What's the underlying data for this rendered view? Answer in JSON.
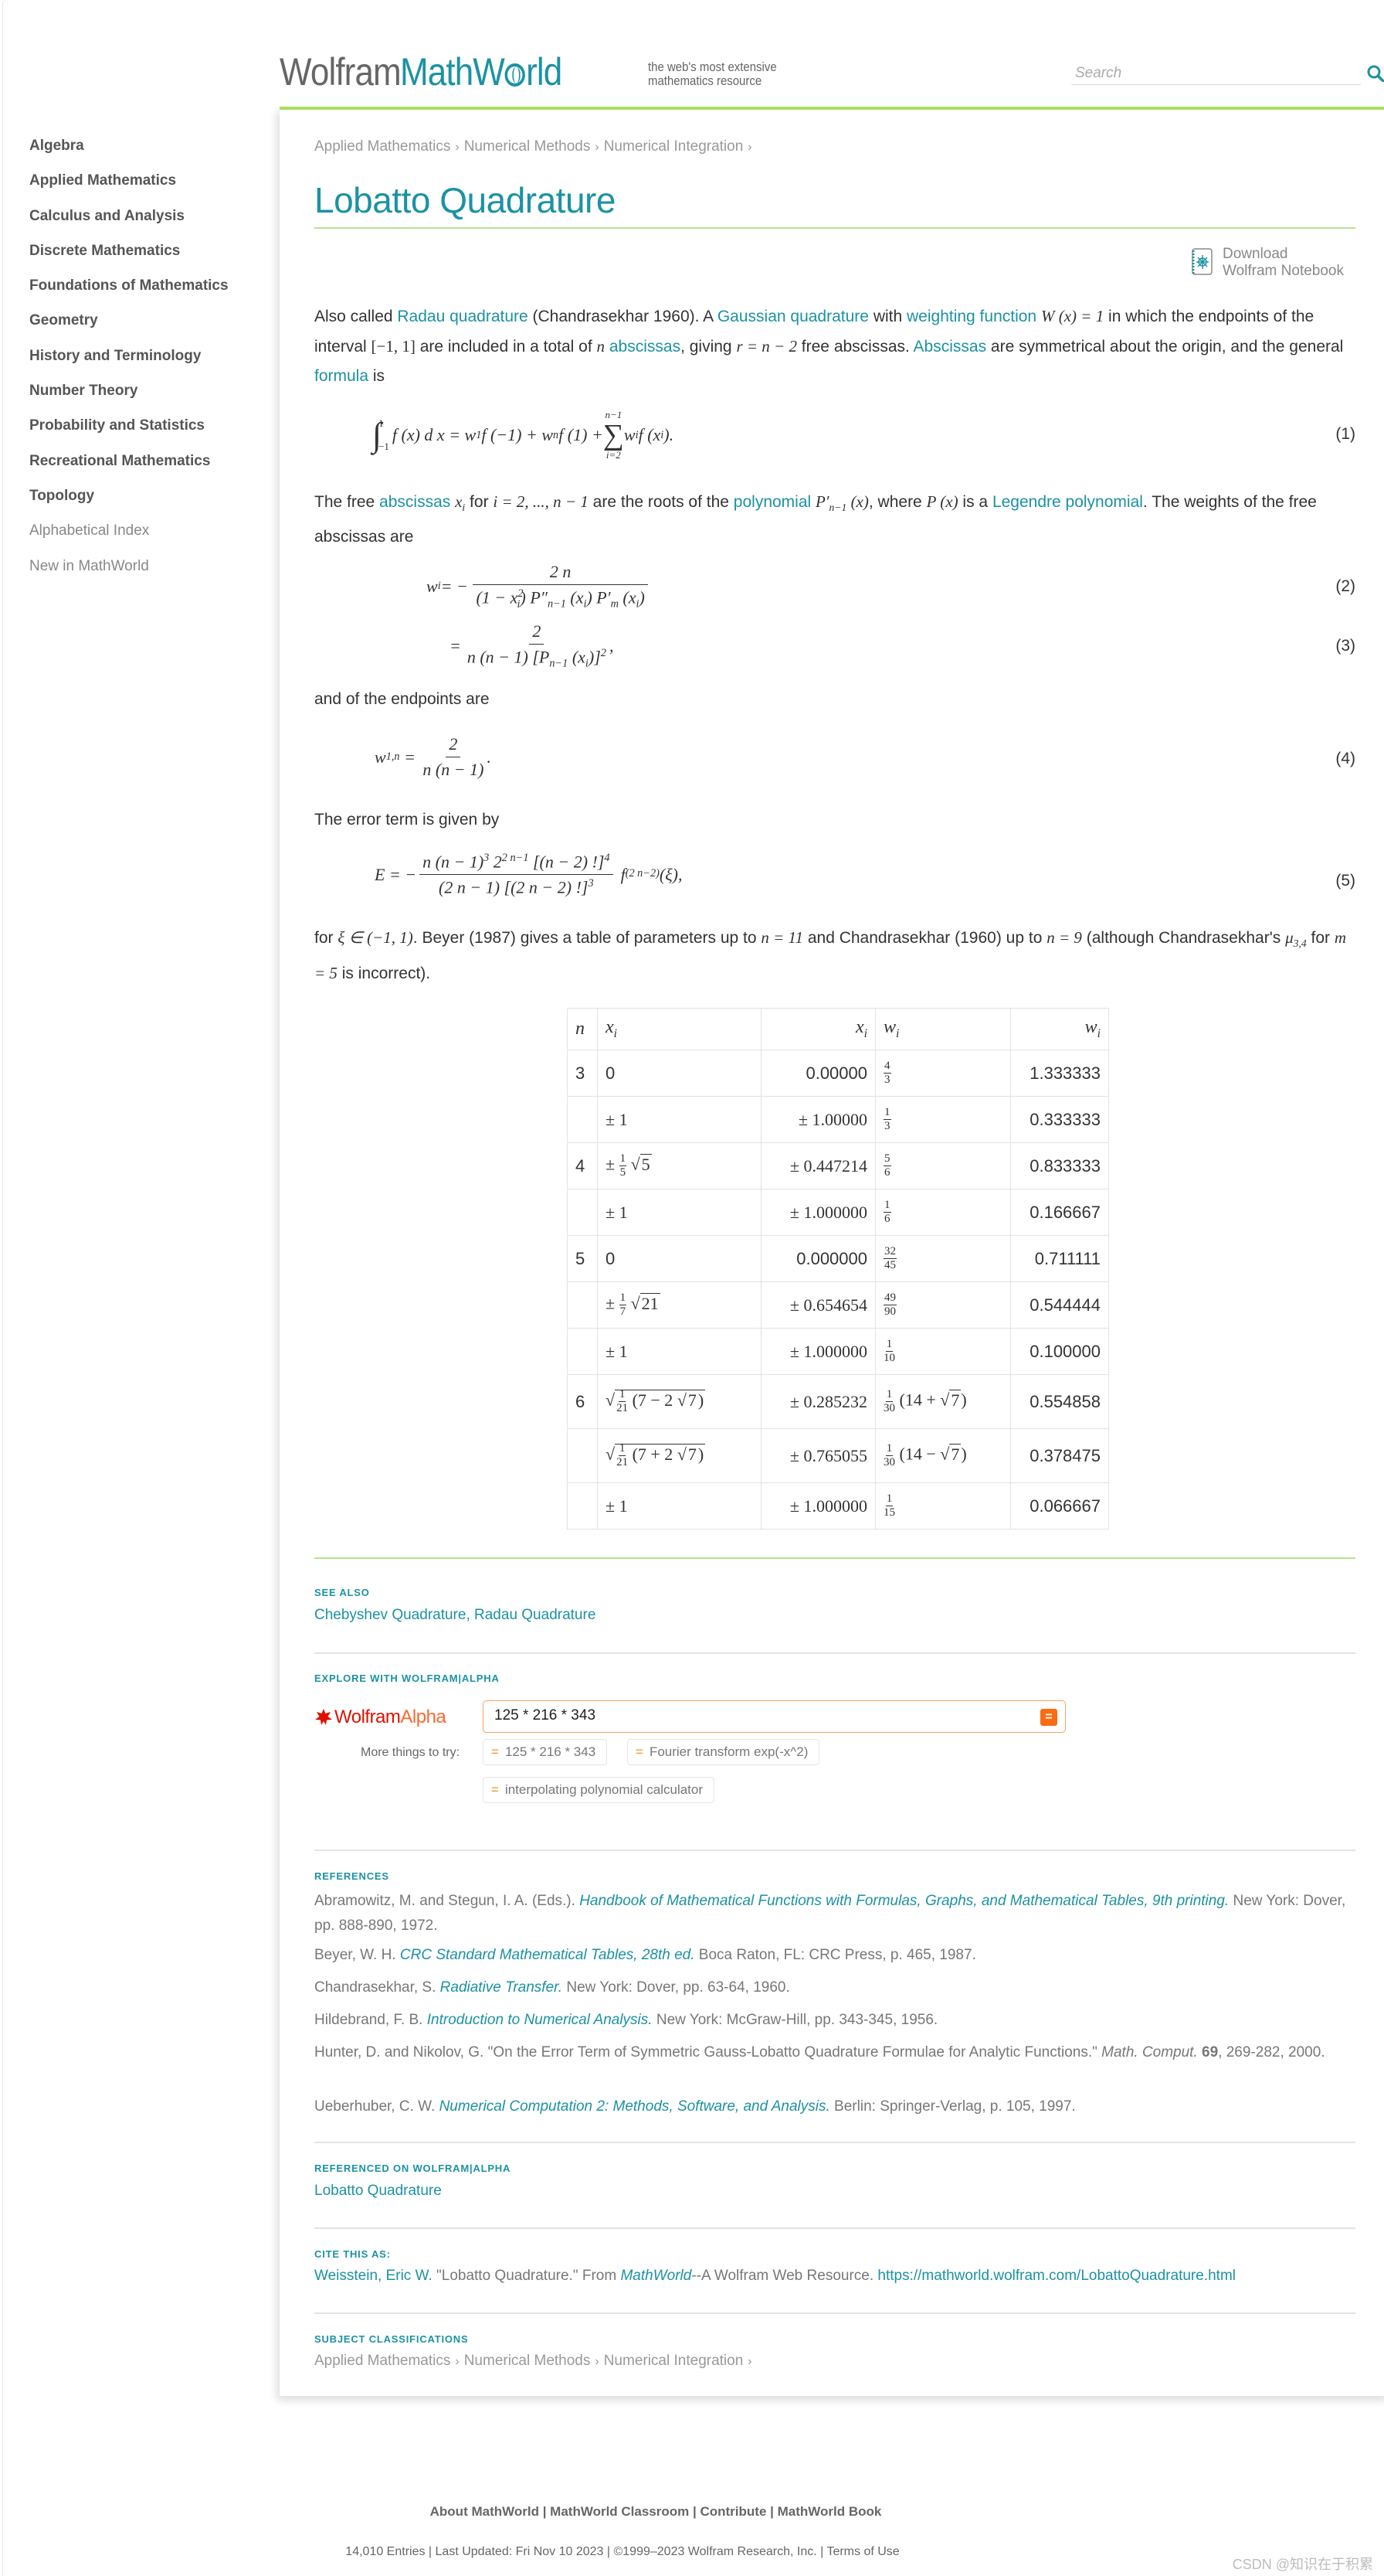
{
  "header": {
    "logo_wolfram": "Wolfram",
    "logo_math": "Math",
    "logo_w": "W",
    "logo_rld": "rld",
    "tagline_line1": "the web's most extensive",
    "tagline_line2": "mathematics resource",
    "search_placeholder": "Search"
  },
  "sidebar": {
    "items": [
      {
        "label": "Algebra"
      },
      {
        "label": "Applied Mathematics"
      },
      {
        "label": "Calculus and Analysis"
      },
      {
        "label": "Discrete Mathematics"
      },
      {
        "label": "Foundations of Mathematics"
      },
      {
        "label": "Geometry"
      },
      {
        "label": "History and Terminology"
      },
      {
        "label": "Number Theory"
      },
      {
        "label": "Probability and Statistics"
      },
      {
        "label": "Recreational Mathematics"
      },
      {
        "label": "Topology"
      }
    ],
    "secondary": [
      {
        "label": "Alphabetical Index"
      },
      {
        "label": "New in MathWorld"
      }
    ]
  },
  "breadcrumb": {
    "items": [
      "Applied Mathematics",
      "Numerical Methods",
      "Numerical Integration"
    ],
    "sep": "›"
  },
  "title": "Lobatto Quadrature",
  "notebook": {
    "line1": "Download",
    "line2": "Wolfram Notebook"
  },
  "intro": {
    "t1": "Also called ",
    "l1": "Radau quadrature",
    "t2": " (Chandrasekhar 1960). A ",
    "l2": "Gaussian quadrature",
    "t3": " with ",
    "l3": "weighting function",
    "m1": "W (x) = 1",
    "t4": " in which the endpoints of the interval ",
    "m2": "[−1, 1]",
    "t5": " are included in a total of ",
    "m3": "n",
    "l4": "abscissas",
    "t6": ", giving ",
    "m4": "r = n − 2",
    "t7": " free abscissas. ",
    "l5": "Abscissas",
    "t8": " are symmetrical about the origin, and the general ",
    "l6": "formula",
    "t9": " is"
  },
  "eq1": {
    "lhs": "f (x) d x = w",
    "mid1": " f (−1) + w",
    "mid2": " f (1) + ",
    "sum_top": "n−1",
    "sum_bot": "i=2",
    "rhs": "w",
    "rhs2": " f (x",
    "rhs3": ").",
    "num": "(1)"
  },
  "para2": {
    "t1": "The free ",
    "l1": "abscissas",
    "m1": "x",
    "t2": " for ",
    "m2": "i = 2, ..., n − 1",
    "t3": " are the roots of the ",
    "l2": "polynomial",
    "m3": "P′",
    "m3sub": "n−1",
    "m3b": " (x)",
    "t4": ", where ",
    "m4": "P (x)",
    "t5": " is a ",
    "l3": "Legendre polynomial",
    "t6": ". The weights of the free abscissas are"
  },
  "eq2": {
    "lhs": "w",
    "eqsign": " = −",
    "num": "2 n",
    "den": "(1 − x",
    "den2": ") P″",
    "den3": " (x",
    "den4": ") P′",
    "den5": " (x",
    "den6": ")",
    "label": "(2)"
  },
  "eq3": {
    "eqsign": "=",
    "num": "2",
    "den": "n (n − 1) [P",
    "den2": " (x",
    "den3": ")]",
    "tail": ",",
    "label": "(3)"
  },
  "para3": "and of the endpoints are",
  "eq4": {
    "lhs": "w",
    "lhs_sub": "1,n",
    "eqsign": " = ",
    "num": "2",
    "den": "n (n − 1)",
    "tail": ".",
    "label": "(4)"
  },
  "para4": "The error term is given by",
  "eq5": {
    "lhs": "E = −",
    "num": "n (n − 1)",
    "num2": " 2",
    "num3": " [(n − 2) !]",
    "den": "(2 n − 1) [(2 n − 2) !]",
    "f": "f",
    "fsup": "(2 n−2)",
    "tail": " (ξ),",
    "label": "(5)"
  },
  "para5": {
    "t1": "for ",
    "m1": "ξ ∈ (−1, 1)",
    "t2": ". Beyer (1987) gives a table of parameters up to ",
    "m2": "n = 11",
    "t3": " and Chandrasekhar (1960) up to ",
    "m3": "n = 9",
    "t4": " (although Chandrasekhar's ",
    "m4": "μ",
    "m4sub": "3,4",
    "t5": " for ",
    "m5": "m = 5",
    "t6": " is incorrect)."
  },
  "table": {
    "headers": [
      "n",
      "x",
      "x",
      "w",
      "w"
    ],
    "header_sub": "i",
    "rows": [
      {
        "n": "3",
        "x_exact": "0",
        "x_num": "0.00000",
        "w_num_n": "4",
        "w_num_d": "3",
        "w_num": "1.333333"
      },
      {
        "n": "",
        "x_exact": "± 1",
        "x_num": "± 1.00000",
        "w_num_n": "1",
        "w_num_d": "3",
        "w_num": "0.333333"
      },
      {
        "n": "4",
        "x_exact_pm": "± ",
        "x_fn": "1",
        "x_fd": "5",
        "x_sqrt": "5",
        "x_num": "± 0.447214",
        "w_num_n": "5",
        "w_num_d": "6",
        "w_num": "0.833333"
      },
      {
        "n": "",
        "x_exact": "± 1",
        "x_num": "± 1.000000",
        "w_num_n": "1",
        "w_num_d": "6",
        "w_num": "0.166667"
      },
      {
        "n": "5",
        "x_exact": "0",
        "x_num": "0.000000",
        "w_num_n": "32",
        "w_num_d": "45",
        "w_num": "0.711111"
      },
      {
        "n": "",
        "x_exact_pm": "± ",
        "x_fn": "1",
        "x_fd": "7",
        "x_sqrt": "21",
        "x_num": "± 0.654654",
        "w_num_n": "49",
        "w_num_d": "90",
        "w_num": "0.544444"
      },
      {
        "n": "",
        "x_exact": "± 1",
        "x_num": "± 1.000000",
        "w_num_n": "1",
        "w_num_d": "10",
        "w_num": "0.100000"
      },
      {
        "n": "6",
        "x_fn": "1",
        "x_fd": "21",
        "x_inner": "(7 − 2 ",
        "x_sqrt": "7",
        "x_close": ")",
        "x_num": "± 0.285232",
        "w_num_n": "1",
        "w_num_d": "30",
        "w_expr": "(14 + ",
        "w_sqrt": "7",
        "w_close": ")",
        "w_num": "0.554858"
      },
      {
        "n": "",
        "x_fn": "1",
        "x_fd": "21",
        "x_inner": "(7 + 2 ",
        "x_sqrt": "7",
        "x_close": ")",
        "x_num": "± 0.765055",
        "w_num_n": "1",
        "w_num_d": "30",
        "w_expr": "(14 − ",
        "w_sqrt": "7",
        "w_close": ")",
        "w_num": "0.378475"
      },
      {
        "n": "",
        "x_exact": "± 1",
        "x_num": "± 1.000000",
        "w_num_n": "1",
        "w_num_d": "15",
        "w_num": "0.066667"
      }
    ]
  },
  "see_also": {
    "title": "SEE ALSO",
    "links": [
      "Chebyshev Quadrature",
      "Radau Quadrature"
    ],
    "sep": ", "
  },
  "explore": {
    "title": "EXPLORE WITH WOLFRAM|ALPHA",
    "logo_wolfram": "Wolfram",
    "logo_alpha": "Alpha",
    "input_value": "125 * 216 * 343",
    "go_label": "=",
    "more_label": "More things to try:",
    "chips": [
      "125 * 216 * 343",
      "Fourier transform exp(-x^2)",
      "interpolating polynomial calculator"
    ],
    "chip_prefix": "="
  },
  "references": {
    "title": "REFERENCES",
    "items": [
      {
        "pre": "Abramowitz, M. and Stegun, I. A. (Eds.). ",
        "link": "Handbook of Mathematical Functions with Formulas, Graphs, and Mathematical Tables, 9th printing.",
        "post": " New York: Dover, pp. 888-890, 1972."
      },
      {
        "pre": "Beyer, W. H. ",
        "link": "CRC Standard Mathematical Tables, 28th ed.",
        "post": " Boca Raton, FL: CRC Press, p. 465, 1987."
      },
      {
        "pre": "Chandrasekhar, S. ",
        "link": "Radiative Transfer.",
        "post": " New York: Dover, pp. 63-64, 1960."
      },
      {
        "pre": "Hildebrand, F. B. ",
        "link": "Introduction to Numerical Analysis.",
        "post": " New York: McGraw-Hill, pp. 343-345, 1956."
      },
      {
        "pre": "Hunter, D. and Nikolov, G. \"On the Error Term of Symmetric Gauss-Lobatto Quadrature Formulae for Analytic Functions.\" ",
        "ital": "Math. Comput.",
        "bold": " 69",
        "post": ", 269-282, 2000."
      },
      {
        "pre": "Ueberhuber, C. W. ",
        "link": "Numerical Computation 2: Methods, Software, and Analysis.",
        "post": " Berlin: Springer-Verlag, p. 105, 1997."
      }
    ]
  },
  "referenced_on": {
    "title": "REFERENCED ON WOLFRAM|ALPHA",
    "link": "Lobatto Quadrature"
  },
  "cite": {
    "title": "CITE THIS AS:",
    "author": "Weisstein, Eric W.",
    "mid": " \"Lobatto Quadrature.\" From ",
    "mw": "MathWorld",
    "mid2": "--A Wolfram Web Resource. ",
    "url": "https://mathworld.wolfram.com/LobattoQuadrature.html"
  },
  "classifications": {
    "title": "SUBJECT CLASSIFICATIONS",
    "items": [
      "Applied Mathematics",
      "Numerical Methods",
      "Numerical Integration"
    ]
  },
  "footer": {
    "links": [
      "About MathWorld",
      "MathWorld Classroom",
      "Contribute",
      "MathWorld Book"
    ],
    "entries": "14,010 Entries",
    "updated": "Last Updated: Fri Nov 10 2023",
    "copyright": "©1999–2023 Wolfram Research, Inc.",
    "terms": "Terms of Use",
    "sep": " | "
  },
  "watermark": "CSDN @知识在于积累",
  "colors": {
    "accent": "#1b92a3",
    "green_rule": "#a8de5c",
    "wa_red": "#dd1100",
    "wa_orange": "#f96c14"
  }
}
